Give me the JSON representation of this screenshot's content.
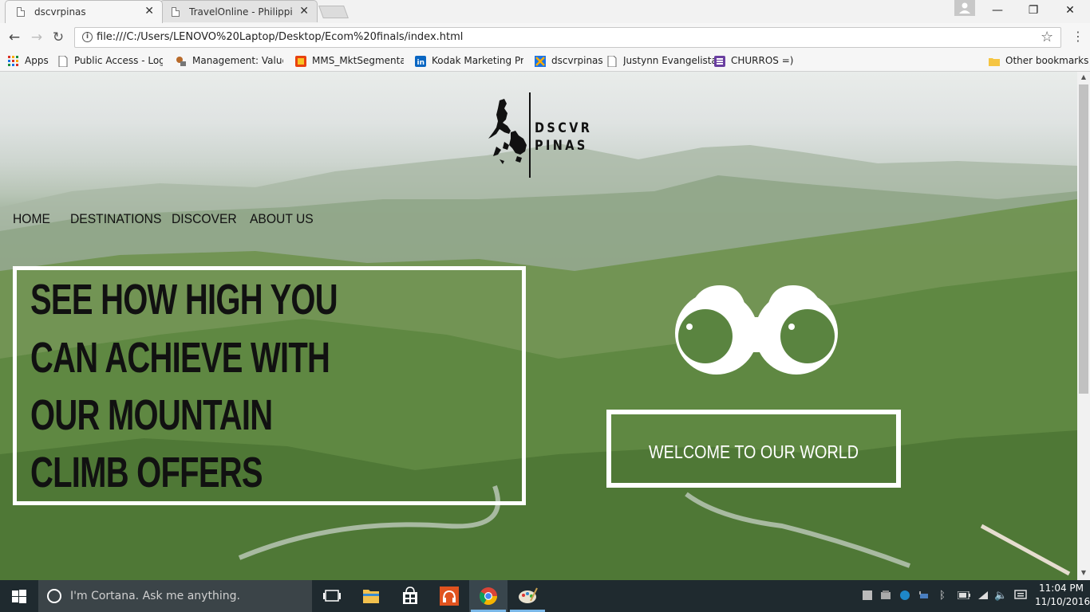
{
  "browser": {
    "tabs": [
      {
        "title": "dscvrpinas",
        "active": true
      },
      {
        "title": "TravelOnline - Philippine",
        "active": false
      }
    ],
    "address": "file:///C:/Users/LENOVO%20Laptop/Desktop/Ecom%20finals/index.html",
    "bookmarks": [
      {
        "label": "Apps",
        "icon": "apps-grid-icon"
      },
      {
        "label": "Public Access - Login",
        "icon": "page-icon"
      },
      {
        "label": "Management: Values (",
        "icon": "mgmt-icon"
      },
      {
        "label": "MMS_MktSegmentati",
        "icon": "mms-icon"
      },
      {
        "label": "Kodak Marketing Pres",
        "icon": "linkedin-icon"
      },
      {
        "label": "dscvrpinas",
        "icon": "dscvr-icon"
      },
      {
        "label": "Justynn Evangelista",
        "icon": "page-icon"
      },
      {
        "label": "CHURROS =)",
        "icon": "churros-icon"
      }
    ],
    "other_bookmarks": "Other bookmarks"
  },
  "site": {
    "logo": {
      "line1": "DSCVR",
      "line2": "PINAS"
    },
    "nav": [
      "HOME",
      "DESTINATIONS",
      "DISCOVER",
      "ABOUT US"
    ],
    "hero_lines": [
      "SEE HOW HIGH YOU",
      "CAN ACHIEVE WITH",
      "OUR MOUNTAIN",
      "CLIMB OFFERS"
    ],
    "welcome": "WELCOME TO OUR WORLD"
  },
  "taskbar": {
    "cortana_placeholder": "I'm Cortana. Ask me anything.",
    "time": "11:04 PM",
    "date": "11/10/2016"
  },
  "colors": {
    "accent_blue": "#1a73e8",
    "taskbar": "#1f2a2f",
    "hero_text": "#111111",
    "frame": "#ffffff"
  }
}
